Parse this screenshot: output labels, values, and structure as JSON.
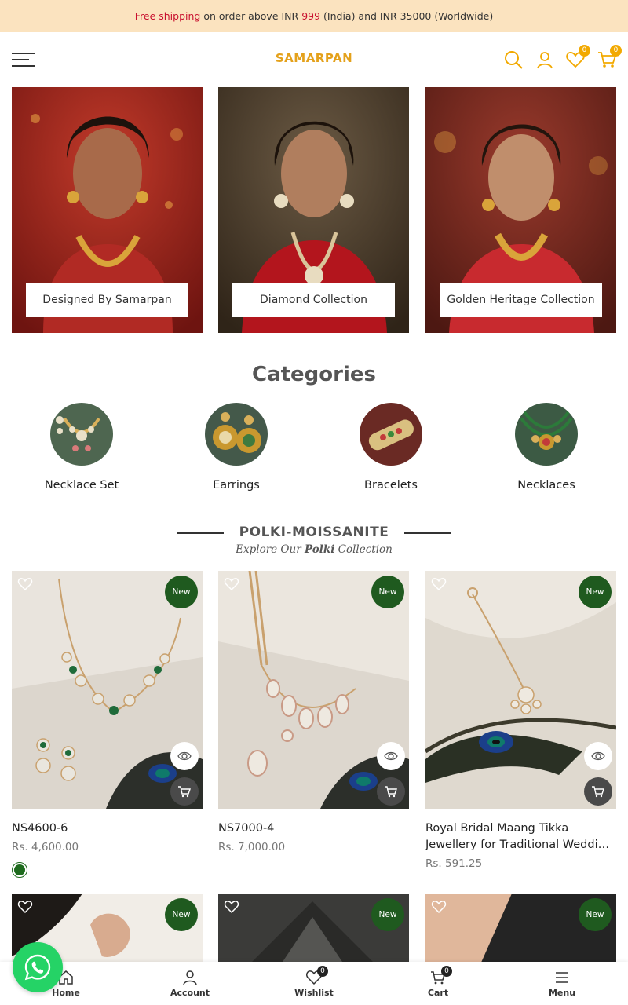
{
  "announcement": {
    "part1": "Free shipping",
    "part2": " on order above INR ",
    "part3": "999",
    "part4": " (India) and INR 35000 (Worldwide)"
  },
  "header": {
    "logo": "SAMARPAN",
    "wishlist_count": "0",
    "cart_count": "0"
  },
  "collections": [
    {
      "label": "Designed By Samarpan"
    },
    {
      "label": "Diamond Collection"
    },
    {
      "label": "Golden Heritage Collection"
    }
  ],
  "categories": {
    "title": "Categories",
    "items": [
      {
        "label": "Necklace Set"
      },
      {
        "label": "Earrings"
      },
      {
        "label": "Bracelets"
      },
      {
        "label": "Necklaces"
      }
    ]
  },
  "polki": {
    "title": "POLKI-MOISSANITE",
    "subtitle_pre": "Explore Our ",
    "subtitle_bold": "Polki",
    "subtitle_post": " Collection"
  },
  "products": [
    {
      "name": "NS4600-6",
      "price": "Rs. 4,600.00",
      "badge": "New",
      "swatch_color": "#1e6b1e"
    },
    {
      "name": "NS7000-4",
      "price": "Rs. 7,000.00",
      "badge": "New"
    },
    {
      "name": "Royal Bridal Maang Tikka Jewellery for Traditional Wedding Look",
      "price": "Rs. 591.25",
      "badge": "New"
    },
    {
      "badge": "New"
    },
    {
      "badge": "New"
    },
    {
      "badge": "New"
    }
  ],
  "bottom_nav": {
    "home": "Home",
    "account": "Account",
    "wishlist": "Wishlist",
    "wishlist_count": "0",
    "cart": "Cart",
    "cart_count": "0",
    "menu": "Menu"
  },
  "colors": {
    "accent": "#f2a900",
    "announcement_bg": "#fbe3bf",
    "new_badge": "#1f5a1f",
    "whatsapp": "#25d366"
  }
}
